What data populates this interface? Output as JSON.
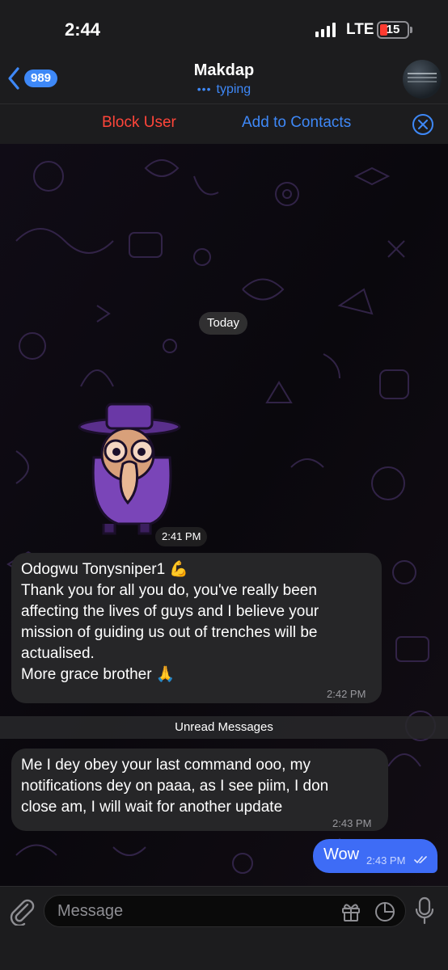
{
  "status_bar": {
    "time": "2:44",
    "network": "LTE",
    "battery": "15"
  },
  "header": {
    "back_count": "989",
    "title": "Makdap",
    "status": "typing",
    "typing_dots": "•••"
  },
  "action_bar": {
    "block_label": "Block User",
    "add_label": "Add to Contacts"
  },
  "chat": {
    "date_label": "Today",
    "sticker_time": "2:41 PM",
    "unread_label": "Unread Messages",
    "messages": [
      {
        "direction": "incoming",
        "lines": [
          "Odogwu Tonysniper1 💪",
          "Thank you for all you do, you've really been",
          "affecting the lives of guys and I believe your",
          "mission of guiding us out of trenches will be",
          "actualised.",
          "More grace brother 🙏"
        ],
        "time": "2:42 PM"
      },
      {
        "direction": "incoming",
        "lines": [
          "Me I dey obey your last command ooo, my",
          "notifications dey on paaa, as I see piim, I don",
          "close am, I will wait for another update"
        ],
        "time": "2:43 PM"
      },
      {
        "direction": "outgoing",
        "text": "Wow",
        "time": "2:43 PM",
        "read": true
      }
    ]
  },
  "input": {
    "placeholder": "Message"
  },
  "colors": {
    "accent": "#3e88f7",
    "danger": "#ff453a",
    "outgoing_bubble": "#3e6cf6",
    "incoming_bubble": "#262628"
  },
  "icons": [
    "chevron-left-icon",
    "close-icon",
    "paperclip-icon",
    "gift-icon",
    "sticker-icon",
    "microphone-icon",
    "double-check-icon"
  ]
}
